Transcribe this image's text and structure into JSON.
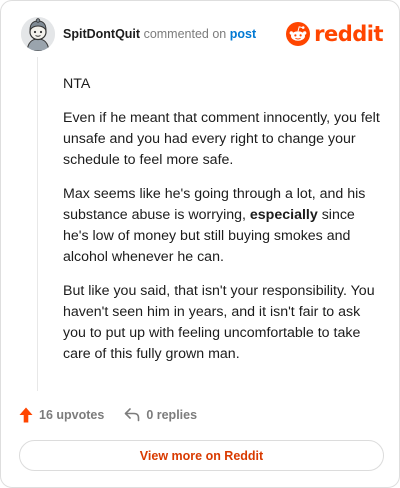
{
  "header": {
    "username": "SpitDontQuit",
    "action_text": "commented on",
    "post_link": "post",
    "brand_name": "reddit"
  },
  "comment": {
    "p1": "NTA",
    "p2": "Even if he meant that comment innocently, you felt unsafe and you had every right to change your schedule to feel more safe.",
    "p3_before": "Max seems like he's going through a lot, and his substance abuse is worrying, ",
    "p3_bold": "especially",
    "p3_after": " since he's low of money but still buying smokes and alcohol whenever he can.",
    "p4": "But like you said, that isn't your responsibility. You haven't seen him in years, and it isn't fair to ask you to put up with feeling uncomfortable to take care of this fully grown man."
  },
  "actions": {
    "upvotes": "16 upvotes",
    "replies": "0 replies"
  },
  "footer": {
    "view_more": "View more on Reddit"
  },
  "colors": {
    "brand": "#ff4500",
    "link": "#0079d3",
    "upvote": "#ff4500",
    "view_more_text": "#d93a00"
  },
  "icons": {
    "avatar": "avatar-icon",
    "brand": "reddit-logo-icon",
    "upvote": "upvote-arrow-icon",
    "reply": "reply-arrow-icon"
  }
}
